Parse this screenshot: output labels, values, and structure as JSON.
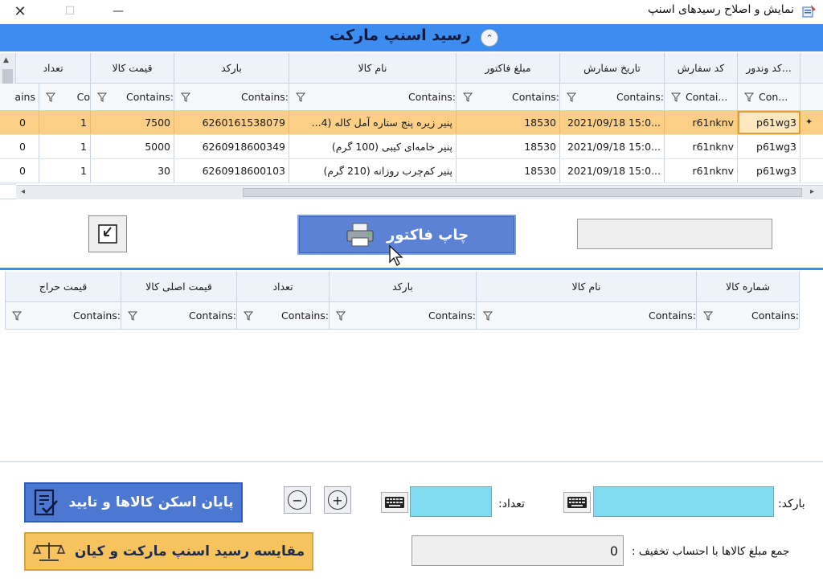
{
  "window": {
    "title": "نمایش و اصلاح رسیدهای اسنپ",
    "close_glyph": "✕",
    "max_glyph": "☐",
    "min_glyph": "—"
  },
  "header": {
    "title": "رسید اسنپ مارکت",
    "collapse_glyph": "⌃"
  },
  "grid1": {
    "columns": [
      "کد وندور...",
      "کد سفارش",
      "تاریخ سفارش",
      "مبلغ فاکتور",
      "نام کالا",
      "بارکد",
      "قیمت کالا",
      "تعداد"
    ],
    "filters": [
      "Con...",
      "Contai...",
      "Contains:",
      "Contains:",
      "Contains:",
      "Contains:",
      "Contains:",
      "Co",
      "ains"
    ],
    "rows": [
      [
        "p61wg3",
        "r61nknv",
        "2021/09/18 15:0...",
        "18530",
        "پنیر زیره پنج ستاره آمل کاله (4...",
        "6260161538079",
        "7500",
        "1",
        "0"
      ],
      [
        "p61wg3",
        "r61nknv",
        "2021/09/18 15:0...",
        "18530",
        "پنیر خامه‌ای کیبی (100 گرم)",
        "6260918600349",
        "5000",
        "1",
        "0"
      ],
      [
        "p61wg3",
        "r61nknv",
        "2021/09/18 15:0...",
        "18530",
        "پنیر کم‌چرب روزانه (210 گرم)",
        "6260918600103",
        "30",
        "1",
        "0"
      ]
    ]
  },
  "print_button": {
    "label": "چاپ فاکتور"
  },
  "grid2": {
    "columns": [
      "شماره کالا",
      "نام کالا",
      "بارکد",
      "تعداد",
      "قیمت اصلی کالا",
      "قیمت حراج"
    ],
    "filters": [
      "Contains:",
      "Contains:",
      "Contains:",
      "Contains:",
      "Contains:",
      "Contains:"
    ]
  },
  "bottom": {
    "barcode_label": "بارکد:",
    "qty_label": "تعداد:",
    "finish_label": "پایان اسکن کالاها و تایید",
    "compare_label": "مقایسه رسید اسنپ مارکت و کیان",
    "total_label": "جمع مبلغ کالاها با احتساب تخفیف :",
    "total_value": "0",
    "plus_glyph": "+",
    "minus_glyph": "−"
  }
}
